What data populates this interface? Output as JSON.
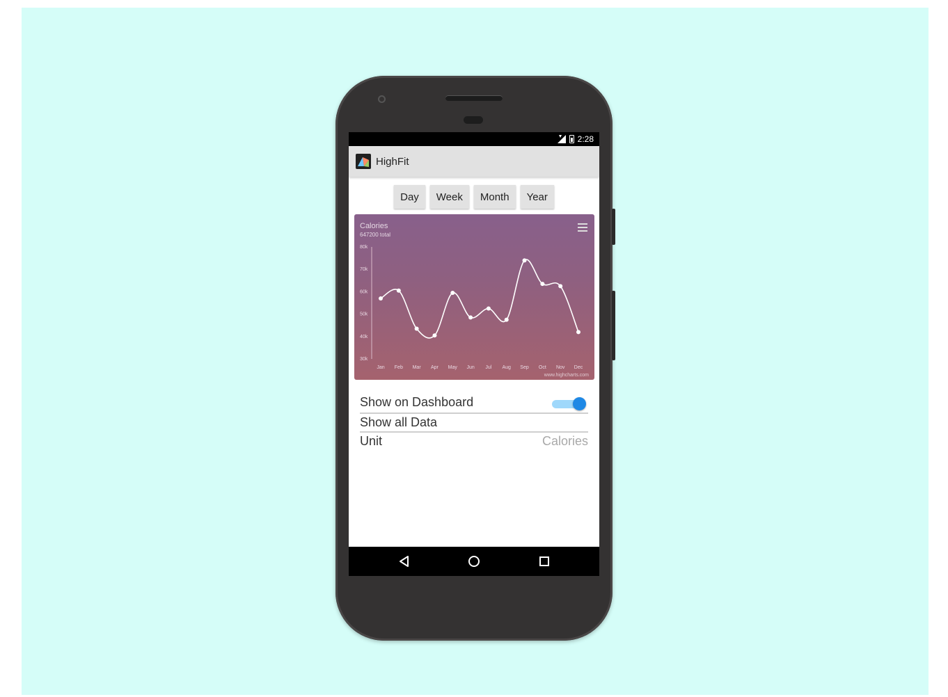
{
  "status": {
    "time": "2:28"
  },
  "app": {
    "title": "HighFit"
  },
  "ranges": [
    "Day",
    "Week",
    "Month",
    "Year"
  ],
  "chart_data": {
    "type": "line",
    "title": "Calories",
    "subtitle": "647200 total",
    "categories": [
      "Jan",
      "Feb",
      "Mar",
      "Apr",
      "May",
      "Jun",
      "Jul",
      "Aug",
      "Sep",
      "Oct",
      "Nov",
      "Dec"
    ],
    "values": [
      57000,
      60500,
      43500,
      40500,
      59500,
      48500,
      52500,
      47500,
      74000,
      63500,
      62500,
      42000
    ],
    "ylim": [
      30000,
      80000
    ],
    "yticks": [
      "30k",
      "40k",
      "50k",
      "60k",
      "70k",
      "80k"
    ],
    "grid": false,
    "credits": "www.highcharts.com",
    "colors": {
      "background_top": "#88608b",
      "background_bottom": "#a5626e",
      "line": "#ffffff"
    }
  },
  "settings": {
    "dashboard_label": "Show on Dashboard",
    "dashboard_on": true,
    "all_data_label": "Show all Data",
    "unit_label": "Unit",
    "unit_value": "Calories"
  },
  "colors": {
    "toggle_accent": "#1e88e5",
    "stage_background": "#d5fdf8"
  },
  "icons": {
    "nav": [
      "back-icon",
      "home-icon",
      "recents-icon"
    ],
    "chart_menu": "hamburger-menu-icon"
  }
}
